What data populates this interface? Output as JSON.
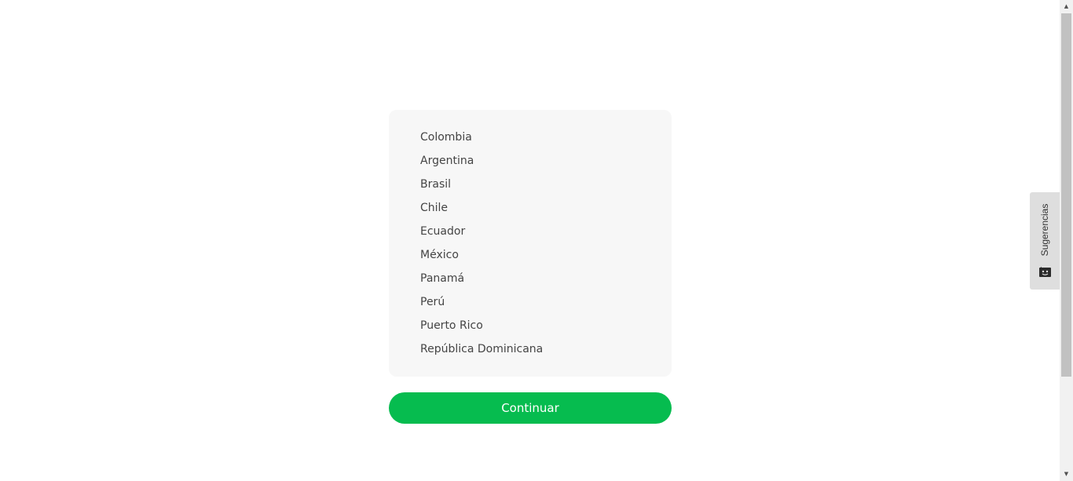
{
  "countries": [
    "Colombia",
    "Argentina",
    "Brasil",
    "Chile",
    "Ecuador",
    "México",
    "Panamá",
    "Perú",
    "Puerto Rico",
    "República Dominicana"
  ],
  "continue_button": {
    "label": "Continuar",
    "color": "#06bc4f"
  },
  "feedback_tab": {
    "label": "Sugerencias",
    "icon": "feedback-face-icon"
  },
  "scrollbar": {
    "up_arrow": "▲",
    "down_arrow": "▼"
  }
}
